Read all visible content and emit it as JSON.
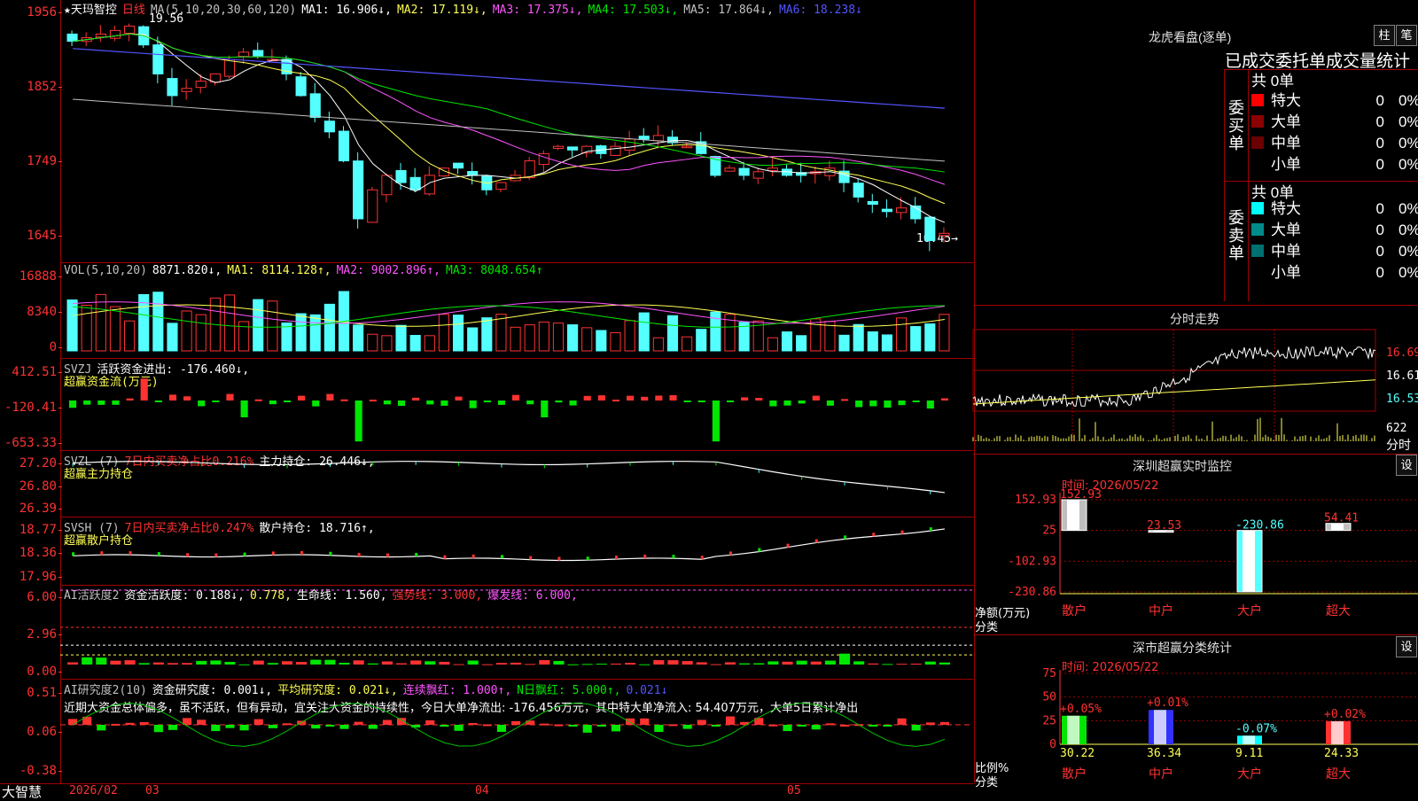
{
  "stock": {
    "name": "★天玛智控",
    "period": "日线",
    "ma_label": "MA(5,10,20,30,60,120)",
    "ma_values": [
      {
        "label": "MA1: 16.906↓,",
        "color": "#ffffff"
      },
      {
        "label": "MA2: 17.119↓,",
        "color": "#ffff54"
      },
      {
        "label": "MA3: 17.375↓,",
        "color": "#ff54ff"
      },
      {
        "label": "MA4: 17.503↓,",
        "color": "#00e600"
      },
      {
        "label": "MA5: 17.864↓,",
        "color": "#c0c0c0"
      },
      {
        "label": "MA6: 18.238↓",
        "color": "#5454ff"
      }
    ],
    "high_marker": "19.56",
    "low_marker": "16.45→",
    "y_ticks": [
      "1956",
      "1852",
      "1749",
      "1645"
    ]
  },
  "vol": {
    "label": "VOL(5,10,20)",
    "value": "8871.820↓,",
    "ma1": "MA1: 8114.128↑,",
    "ma2": "MA2: 9002.896↑,",
    "ma3": "MA3: 8048.654↑",
    "y_ticks": [
      "16888",
      "8340",
      "0"
    ]
  },
  "svzj": {
    "label": "SVZJ",
    "line1": "活跃资金进出: -176.460↓,",
    "line2": "超赢资金流(万元)",
    "y_ticks": [
      "412.51",
      "-120.41",
      "-653.33"
    ]
  },
  "svzl": {
    "label": "SVZL (7)",
    "ratio": "7日内买卖净占比0.216%",
    "hold": "主力持仓: 26.446↓,",
    "line2": "超赢主力持仓",
    "y_ticks": [
      "27.20",
      "26.80",
      "26.39"
    ]
  },
  "svsh": {
    "label": "SVSH (7)",
    "ratio": "7日内买卖净占比0.247%",
    "hold": "散户持仓: 18.716↑,",
    "line2": "超赢散户持仓",
    "y_ticks": [
      "18.77",
      "18.36",
      "17.96"
    ]
  },
  "ai_active": {
    "label": "AI活跃度2",
    "v1": "资金活跃度: 0.188↓,",
    "v2": "0.778,",
    "v3": "生命线: 1.560,",
    "v4": "强势线: 3.000,",
    "v5": "爆发线: 6.000,",
    "y_ticks": [
      "6.00",
      "2.96",
      "0.00"
    ]
  },
  "ai_research": {
    "label": "AI研究度2(10)",
    "v1": "资金研究度: 0.001↓,",
    "v2": "平均研究度: 0.021↓,",
    "v3": "连续飘红: 1.000↑,",
    "v4": "N日飘红: 5.000↑,",
    "v5": "0.021↓",
    "comment": "近期大资金总体偏多，虽不活跃，但有异动，宜关注大资金的持续性，今日大单净流出: -176.456万元，其中特大单净流入: 54.407万元，大单5日累计净出",
    "y_ticks": [
      "0.51",
      "0.06",
      "-0.38"
    ]
  },
  "time_axis": {
    "brand": "大智慧",
    "labels": [
      "2026/02",
      "03",
      "04",
      "05"
    ]
  },
  "longhu": {
    "title": "龙虎看盘(逐单)",
    "btn1": "柱",
    "btn2": "笔",
    "header": "已成交委托单成交量统计",
    "buy_label": "委买单",
    "sell_label": "委卖单",
    "buy_total": "共 0单",
    "sell_total": "共 0单",
    "buy_rows": [
      {
        "name": "特大",
        "count": "0",
        "pct": "0%",
        "color": "#ff0000"
      },
      {
        "name": "大单",
        "count": "0",
        "pct": "0%",
        "color": "#8b0000"
      },
      {
        "name": "中单",
        "count": "0",
        "pct": "0%",
        "color": "#6b0000"
      },
      {
        "name": "小单",
        "count": "0",
        "pct": "0%",
        "color": ""
      }
    ],
    "sell_rows": [
      {
        "name": "特大",
        "count": "0",
        "pct": "0%",
        "color": "#00ffff"
      },
      {
        "name": "大单",
        "count": "0",
        "pct": "0%",
        "color": "#008b8b"
      },
      {
        "name": "中单",
        "count": "0",
        "pct": "0%",
        "color": "#007070"
      },
      {
        "name": "小单",
        "count": "0",
        "pct": "0%",
        "color": ""
      }
    ]
  },
  "intraday": {
    "title": "分时走势",
    "y_ticks": [
      "16.69",
      "16.61",
      "16.53"
    ],
    "vol_label": "622",
    "unit": "分时"
  },
  "monitor": {
    "title": "深圳超赢实时监控",
    "btn": "设",
    "date": "时间: 2026/05/22",
    "y_ticks": [
      "152.93",
      "25",
      "-102.93",
      "-230.86"
    ],
    "bars": [
      {
        "label": "散户",
        "value": 152.93,
        "text": "152.93"
      },
      {
        "label": "中户",
        "value": 23.53,
        "text": "23.53"
      },
      {
        "label": "大户",
        "value": -230.86,
        "text": "-230.86"
      },
      {
        "label": "超大",
        "value": 54.41,
        "text": "54.41"
      }
    ],
    "ylabel1": "净额(万元)",
    "ylabel2": "分类"
  },
  "category": {
    "title": "深市超赢分类统计",
    "btn": "设",
    "date": "时间: 2026/05/22",
    "y_ticks": [
      "75",
      "50",
      "25",
      "0"
    ],
    "bars": [
      {
        "label": "散户",
        "value": 30.22,
        "change": "+0.05%",
        "text": "30.22",
        "color": "#00e600"
      },
      {
        "label": "中户",
        "value": 36.34,
        "change": "+0.01%",
        "text": "36.34",
        "color": "#3232ff"
      },
      {
        "label": "大户",
        "value": 9.11,
        "change": "-0.07%",
        "text": "9.11",
        "color": "#00ffff"
      },
      {
        "label": "超大",
        "value": 24.33,
        "change": "+0.02%",
        "text": "24.33",
        "color": "#ff3232"
      }
    ],
    "ylabel1": "比例%",
    "ylabel2": "分类"
  }
}
